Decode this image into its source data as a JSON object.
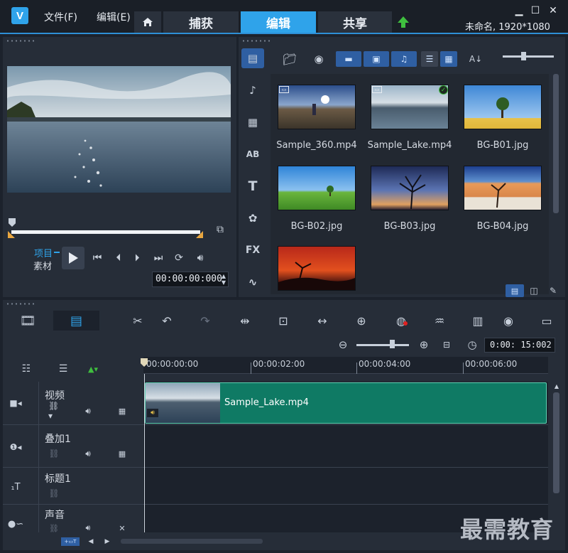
{
  "app": {
    "menus": [
      "文件(F)",
      "编辑(E)"
    ],
    "tabs": [
      "捕获",
      "编辑",
      "共享"
    ],
    "active_tab": "编辑",
    "project_info": "未命名, 1920*1080"
  },
  "player": {
    "mode_project": "项目",
    "mode_clip": "素材",
    "timecode": "00:00:00:000"
  },
  "sidebar_labels": {
    "fx": "FX"
  },
  "library": {
    "items": [
      {
        "name": "Sample_360.mp4",
        "type": "video"
      },
      {
        "name": "Sample_Lake.mp4",
        "type": "video",
        "used": true
      },
      {
        "name": "BG-B01.jpg",
        "type": "image"
      },
      {
        "name": "BG-B02.jpg",
        "type": "image"
      },
      {
        "name": "BG-B03.jpg",
        "type": "image"
      },
      {
        "name": "BG-B04.jpg",
        "type": "image"
      },
      {
        "name": "",
        "type": "image"
      }
    ]
  },
  "timeline": {
    "duration": "0:00: 15:002",
    "ruler": [
      "00:00:00:00",
      "00:00:02:00",
      "00:00:04:00",
      "00:00:06:00"
    ],
    "tracks": [
      {
        "name": "视频"
      },
      {
        "name": "叠加1"
      },
      {
        "name": "标题1"
      },
      {
        "name": "声音"
      }
    ],
    "clip": "Sample_Lake.mp4"
  },
  "watermark": "最需教育",
  "colors": {
    "accent": "#2fa3ea",
    "clip": "#0f7a64",
    "upload_arrow": "#3fbf3f"
  }
}
